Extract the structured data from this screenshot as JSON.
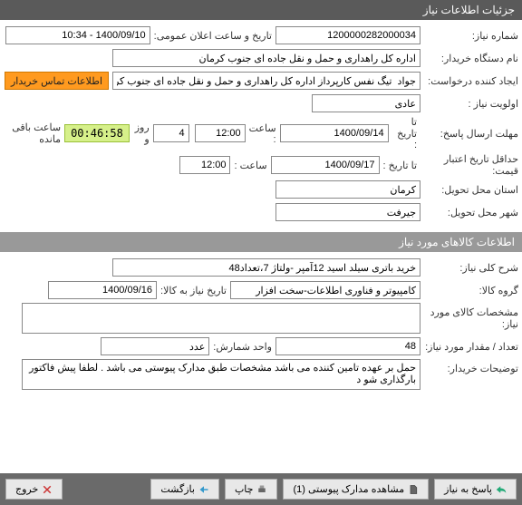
{
  "header": {
    "title": "جزئیات اطلاعات نیاز"
  },
  "sectionItems": {
    "title": "اطلاعات کالاهای مورد نیاز"
  },
  "labels": {
    "needNo": "شماره نیاز:",
    "announceDate": "تاریخ و ساعت اعلان عمومی:",
    "buyer": "نام دستگاه خریدار:",
    "creator": "ایجاد کننده درخواست:",
    "priority": "اولویت نیاز :",
    "replyDeadline": "مهلت ارسال پاسخ:",
    "toDate1": "تا تاریخ :",
    "atTime": "ساعت :",
    "priceValidity": "حداقل تاریخ اعتبار قیمت:",
    "toDate2": "تا تاریخ :",
    "deliveryProvince": "استان محل تحویل:",
    "deliveryCity": "شهر محل تحویل:",
    "daysAnd": "روز و",
    "remaining": "ساعت باقی مانده",
    "needDesc": "شرح کلی نیاز:",
    "group": "گروه کالا:",
    "needByDate": "تاریخ نیاز به کالا:",
    "itemSpec": "مشخصات کالای مورد نیاز:",
    "qty": "تعداد / مقدار مورد نیاز:",
    "unit": "واحد شمارش:",
    "buyerNotes": "توضیحات خریدار:"
  },
  "values": {
    "needNo": "1200000282000034",
    "announceDate": "1400/09/10 - 10:34",
    "buyer": "اداره کل راهداری و حمل و نقل جاده ای جنوب کرمان",
    "creator": "جواد  تیگ نفس کارپرداز اداره کل راهداری و حمل و نقل جاده ای جنوب کرمان",
    "priority": "عادی",
    "date1": "1400/09/14",
    "time1": "12:00",
    "days": "4",
    "timer": "00:46:58",
    "date2": "1400/09/17",
    "time2": "12:00",
    "province": "کرمان",
    "city": "جیرفت",
    "needDesc": "خرید باتری سیلد اسید 12آمپر -ولتاژ 7،تعداد48",
    "group": "کامپیوتر و فناوری اطلاعات-سخت افزار",
    "needByDate": "1400/09/16",
    "itemSpec": "",
    "qty": "48",
    "unit": "عدد",
    "buyerNotes": "حمل بر عهده تامین کننده می باشد مشخصات طبق مدارک پیوستی می باشد . لطفا پیش فاکتور بارگذاری شو د"
  },
  "buttons": {
    "contact": "اطلاعات تماس خریدار",
    "reply": "پاسخ به نیاز",
    "attachments": "مشاهده مدارک پیوستی (1)",
    "print": "چاپ",
    "back": "بازگشت",
    "exit": "خروج"
  }
}
